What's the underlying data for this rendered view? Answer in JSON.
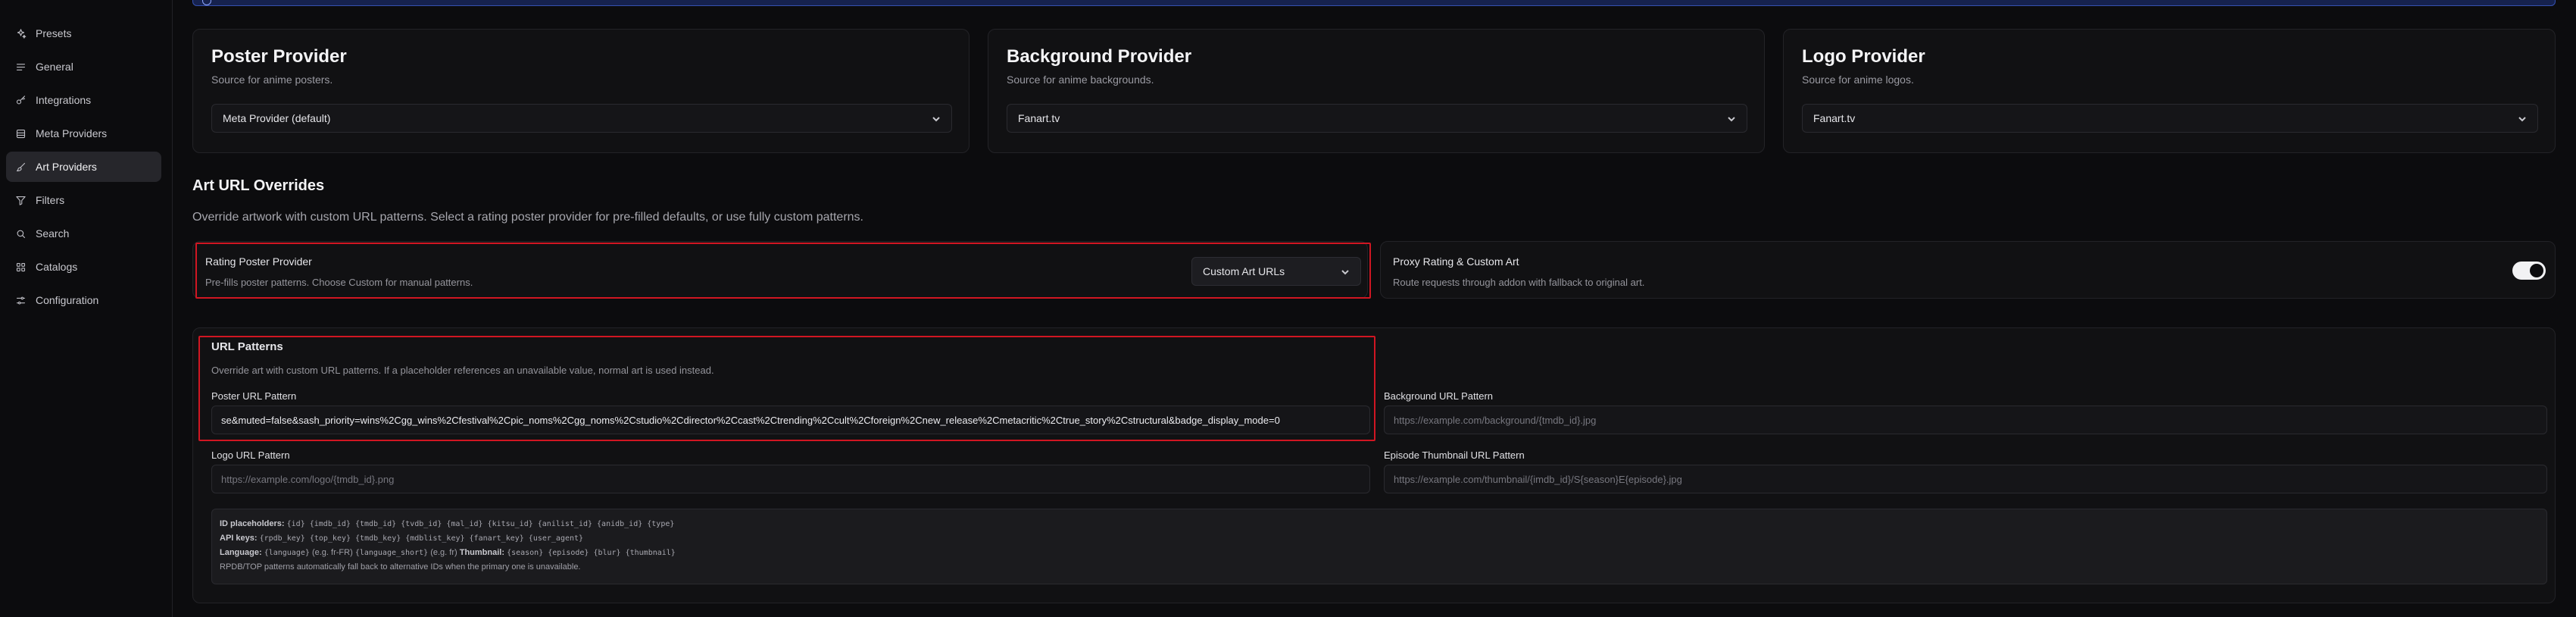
{
  "sidebar": {
    "items": [
      {
        "label": "Presets",
        "icon": "sparkles-icon",
        "active": false
      },
      {
        "label": "General",
        "icon": "list-icon",
        "active": false
      },
      {
        "label": "Integrations",
        "icon": "key-icon",
        "active": false
      },
      {
        "label": "Meta Providers",
        "icon": "database-icon",
        "active": false
      },
      {
        "label": "Art Providers",
        "icon": "brush-icon",
        "active": true
      },
      {
        "label": "Filters",
        "icon": "filter-icon",
        "active": false
      },
      {
        "label": "Search",
        "icon": "search-icon",
        "active": false
      },
      {
        "label": "Catalogs",
        "icon": "grid-icon",
        "active": false
      },
      {
        "label": "Configuration",
        "icon": "sliders-icon",
        "active": false
      }
    ]
  },
  "providers": {
    "poster": {
      "title": "Poster Provider",
      "subtitle": "Source for anime posters.",
      "value": "Meta Provider (default)"
    },
    "background": {
      "title": "Background Provider",
      "subtitle": "Source for anime backgrounds.",
      "value": "Fanart.tv"
    },
    "logo": {
      "title": "Logo Provider",
      "subtitle": "Source for anime logos.",
      "value": "Fanart.tv"
    }
  },
  "overrides": {
    "title": "Art URL Overrides",
    "description": "Override artwork with custom URL patterns. Select a rating poster provider for pre-filled defaults, or use fully custom patterns.",
    "rating": {
      "title": "Rating Poster Provider",
      "description": "Pre-fills poster patterns. Choose Custom for manual patterns.",
      "value": "Custom Art URLs"
    },
    "proxy": {
      "title": "Proxy Rating & Custom Art",
      "description": "Route requests through addon with fallback to original art.",
      "enabled": true
    }
  },
  "patterns": {
    "title": "URL Patterns",
    "description": "Override art with custom URL patterns. If a placeholder references an unavailable value, normal art is used instead.",
    "poster": {
      "label": "Poster URL Pattern",
      "value": "se&muted=false&sash_priority=wins%2Cgg_wins%2Cfestival%2Cpic_noms%2Cgg_noms%2Cstudio%2Cdirector%2Ccast%2Ctrending%2Ccult%2Cforeign%2Cnew_release%2Cmetacritic%2Ctrue_story%2Cstructural&badge_display_mode=0"
    },
    "background": {
      "label": "Background URL Pattern",
      "placeholder": "https://example.com/background/{tmdb_id}.jpg"
    },
    "logo": {
      "label": "Logo URL Pattern",
      "placeholder": "https://example.com/logo/{tmdb_id}.png"
    },
    "thumbnail": {
      "label": "Episode Thumbnail URL Pattern",
      "placeholder": "https://example.com/thumbnail/{imdb_id}/S{season}E{episode}.jpg"
    }
  },
  "placeholders": {
    "id_label": "ID placeholders:",
    "id_values": "{id} {imdb_id} {tmdb_id} {tvdb_id} {mal_id} {kitsu_id} {anilist_id} {anidb_id} {type}",
    "api_label": "API keys:",
    "api_values": "{rpdb_key} {top_key} {tmdb_key} {mdblist_key} {fanart_key} {user_agent}",
    "lang_label": "Language:",
    "lang_values_a": "{language}",
    "lang_eg_a": "(e.g. fr-FR)",
    "lang_values_b": "{language_short}",
    "lang_eg_b": "(e.g. fr)",
    "thumb_label": "Thumbnail:",
    "thumb_values": "{season} {episode} {blur} {thumbnail}",
    "note": "RPDB/TOP patterns automatically fall back to alternative IDs when the primary one is unavailable."
  },
  "colors": {
    "accent_red": "#d01622",
    "banner": "#16224e"
  }
}
